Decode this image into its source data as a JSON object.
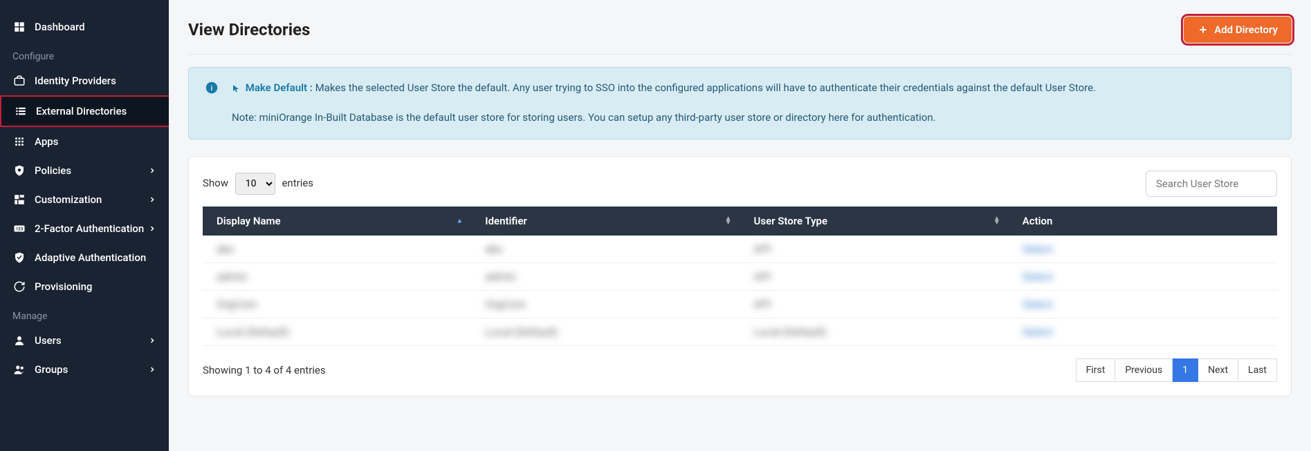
{
  "sidebar": {
    "sections": {
      "top": [
        {
          "label": "Dashboard",
          "icon": "dashboard"
        }
      ],
      "configure_label": "Configure",
      "configure": [
        {
          "label": "Identity Providers",
          "icon": "briefcase",
          "expandable": false
        },
        {
          "label": "External Directories",
          "icon": "list",
          "expandable": false,
          "active": true
        },
        {
          "label": "Apps",
          "icon": "grid",
          "expandable": false
        },
        {
          "label": "Policies",
          "icon": "shield",
          "expandable": true
        },
        {
          "label": "Customization",
          "icon": "sliders",
          "expandable": true
        },
        {
          "label": "2-Factor Authentication",
          "icon": "numeric",
          "expandable": true
        },
        {
          "label": "Adaptive Authentication",
          "icon": "shield-check",
          "expandable": false
        },
        {
          "label": "Provisioning",
          "icon": "sync",
          "expandable": false
        }
      ],
      "manage_label": "Manage",
      "manage": [
        {
          "label": "Users",
          "icon": "user",
          "expandable": true
        },
        {
          "label": "Groups",
          "icon": "users",
          "expandable": true
        }
      ]
    }
  },
  "page": {
    "title": "View Directories",
    "add_button": "Add Directory"
  },
  "info": {
    "heading": "Make Default :",
    "body": "Makes the selected User Store the default. Any user trying to SSO into the configured applications will have to authenticate their credentials against the default User Store.",
    "note": "Note: miniOrange In-Built Database is the default user store for storing users. You can setup any third-party user store or directory here for authentication."
  },
  "table": {
    "show_label_pre": "Show",
    "show_label_post": "entries",
    "page_size": "10",
    "search_placeholder": "Search User Store",
    "columns": [
      "Display Name",
      "Identifier",
      "User Store Type",
      "Action"
    ],
    "rows": [
      {
        "name": "abc",
        "identifier": "abc",
        "type": "API",
        "action": "Select"
      },
      {
        "name": "admin",
        "identifier": "admin",
        "type": "API",
        "action": "Select"
      },
      {
        "name": "OrgCom",
        "identifier": "OrgCom",
        "type": "API",
        "action": "Select"
      },
      {
        "name": "Local (Default)",
        "identifier": "Local (Default)",
        "type": "Local (Default)",
        "action": "Select"
      }
    ],
    "footer_info": "Showing 1 to 4 of 4 entries",
    "pagination": {
      "first": "First",
      "prev": "Previous",
      "pages": [
        "1"
      ],
      "next": "Next",
      "last": "Last"
    }
  }
}
